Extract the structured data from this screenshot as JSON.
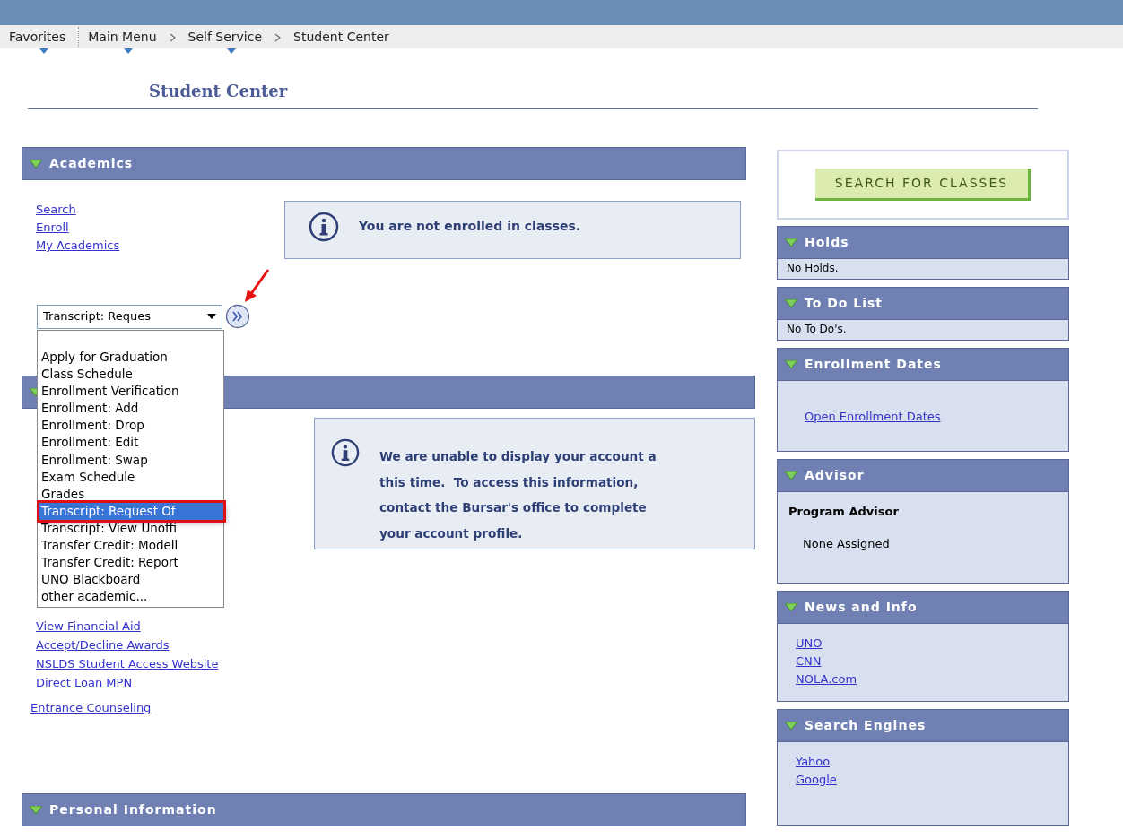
{
  "breadcrumb": [
    {
      "label": "Favorites",
      "menu": true
    },
    {
      "label": "Main Menu",
      "menu": true
    },
    {
      "label": "Self Service",
      "menu": true
    },
    {
      "label": "Student Center",
      "menu": false
    }
  ],
  "page_title": "Student Center",
  "academics": {
    "title": "Academics",
    "expanded": true,
    "links": [
      "Search",
      "Enroll",
      "My Academics"
    ],
    "message": "You are not enrolled in classes.",
    "select_value": "Transcript: Reques",
    "options": [
      {
        "label": "Apply for Graduation",
        "selected": false
      },
      {
        "label": "Class Schedule",
        "selected": false
      },
      {
        "label": "Enrollment Verification",
        "selected": false
      },
      {
        "label": "Enrollment: Add",
        "selected": false
      },
      {
        "label": "Enrollment: Drop",
        "selected": false
      },
      {
        "label": "Enrollment: Edit",
        "selected": false
      },
      {
        "label": "Enrollment: Swap",
        "selected": false
      },
      {
        "label": "Exam Schedule",
        "selected": false
      },
      {
        "label": "Grades",
        "selected": false
      },
      {
        "label": "Transcript: Request Of",
        "selected": true
      },
      {
        "label": "Transcript: View Unoffi",
        "selected": false
      },
      {
        "label": "Transfer Credit: Modell",
        "selected": false
      },
      {
        "label": "Transfer Credit: Report",
        "selected": false
      },
      {
        "label": "UNO Blackboard",
        "selected": false
      },
      {
        "label": "other academic...",
        "selected": false
      }
    ]
  },
  "finances": {
    "expanded": true,
    "message_lines": [
      "We are unable to display your account a",
      "this time.  To access this information,",
      "contact the Bursar's office to complete",
      "your account profile."
    ],
    "links": [
      "View Financial Aid",
      "Accept/Decline Awards",
      "NSLDS Student Access Website",
      "Direct Loan MPN"
    ],
    "extra_link": "Entrance Counseling"
  },
  "personal_information": {
    "title": "Personal Information",
    "expanded": true
  },
  "search_button": "SEARCH FOR CLASSES",
  "sidebar": [
    {
      "title": "Holds",
      "expanded": true,
      "kind": "text",
      "text": "No Holds."
    },
    {
      "title": "To Do List",
      "expanded": true,
      "kind": "text",
      "text": "No To Do's."
    },
    {
      "title": "Enrollment Dates",
      "expanded": true,
      "kind": "links",
      "links": [
        "Open Enrollment Dates"
      ]
    },
    {
      "title": "Advisor",
      "expanded": true,
      "kind": "advisor",
      "label": "Program Advisor",
      "text": "None Assigned"
    },
    {
      "title": "News and Info",
      "expanded": true,
      "kind": "links",
      "links": [
        "UNO",
        "CNN",
        "NOLA.com"
      ]
    },
    {
      "title": "Search Engines",
      "expanded": true,
      "kind": "links",
      "links": [
        "Yahoo",
        "Google"
      ]
    }
  ]
}
